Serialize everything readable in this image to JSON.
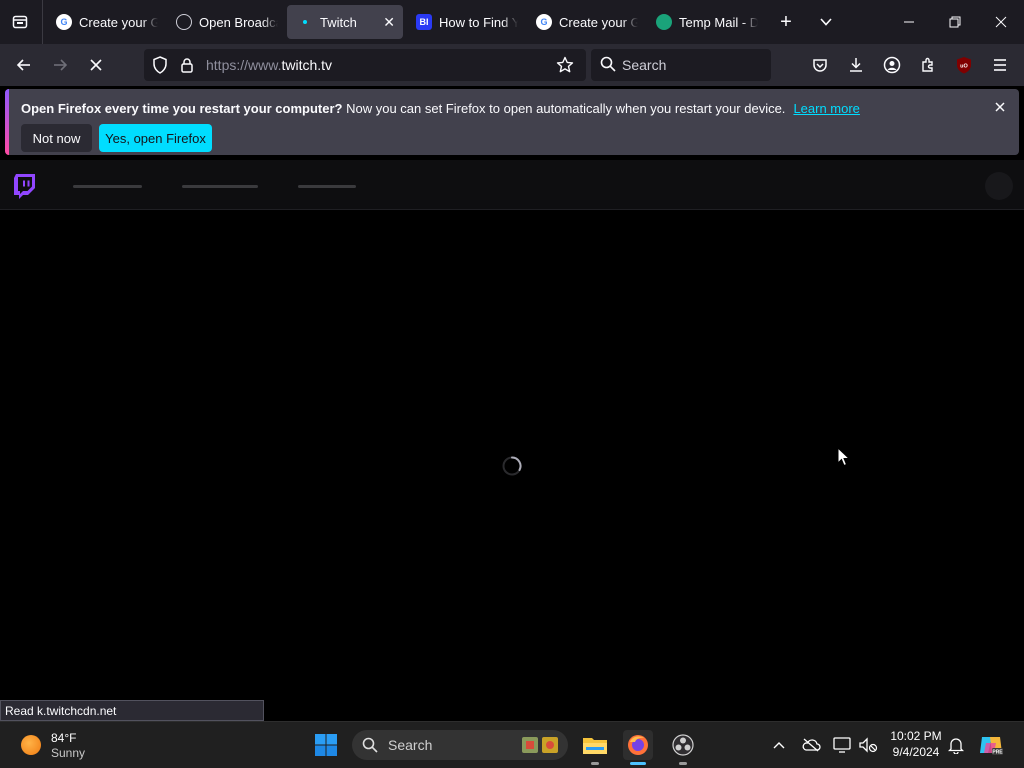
{
  "tabs": [
    {
      "title": "Create your Google Account",
      "favicon": "google-icon",
      "active": false
    },
    {
      "title": "Open Broadcaster Software",
      "favicon": "obs-icon",
      "active": false
    },
    {
      "title": "Twitch",
      "favicon": "twitch-icon",
      "active": true
    },
    {
      "title": "How to Find Your Twitch Stream Key",
      "favicon": "bi-icon",
      "favicon_text": "BI",
      "active": false
    },
    {
      "title": "Create your Google Account",
      "favicon": "google-icon",
      "active": false
    },
    {
      "title": "Temp Mail - Disposable",
      "favicon": "tempmail-icon",
      "active": false
    }
  ],
  "window_controls": {
    "new_tab": "+",
    "list_tabs": "⌄",
    "minimize": "—",
    "restore": "❐",
    "close": "✕"
  },
  "navbar": {
    "url_prefix": "https://www.",
    "url_domain": "twitch.tv",
    "search_placeholder": "Search"
  },
  "notification": {
    "title": "Open Firefox every time you restart your computer?",
    "message": " Now you can set Firefox to open automatically when you restart your device.",
    "link": "Learn more",
    "not_now": "Not now",
    "open": "Yes, open Firefox"
  },
  "status": "Read k.twitchcdn.net",
  "taskbar": {
    "weather_temp": "84°F",
    "weather_desc": "Sunny",
    "search_placeholder": "Search",
    "time": "10:02 PM",
    "date": "9/4/2024"
  },
  "colors": {
    "accent": "#00ddff",
    "twitch": "#9146ff",
    "tab_bg": "#1c1b22",
    "toolbar_bg": "#2b2a33"
  }
}
